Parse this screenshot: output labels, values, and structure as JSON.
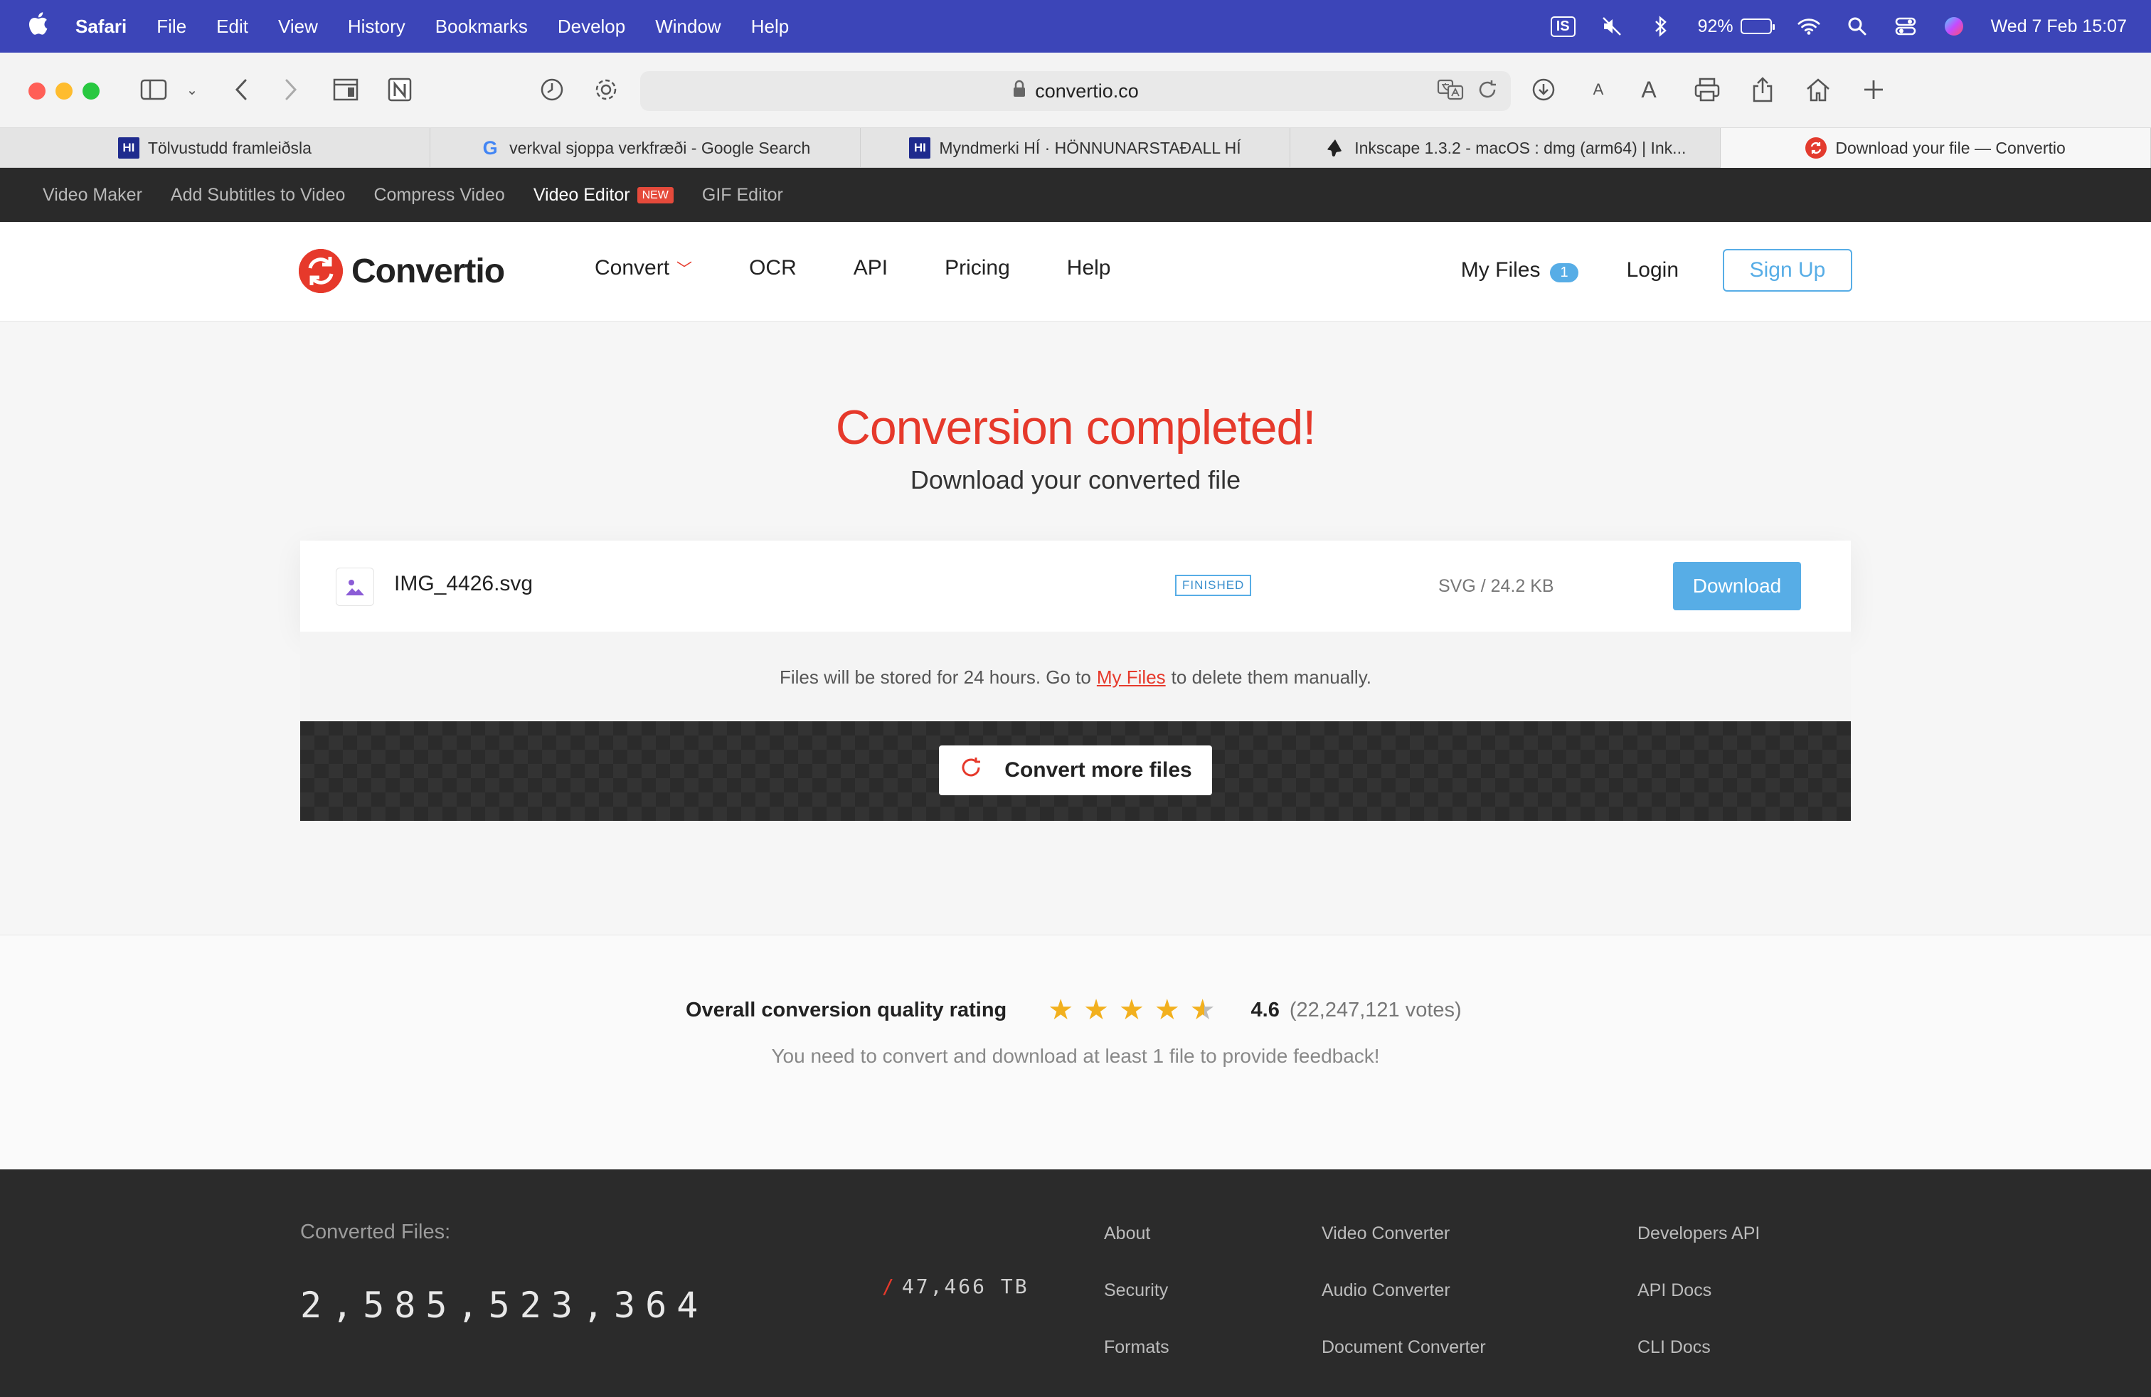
{
  "menubar": {
    "apple": "",
    "items": [
      "Safari",
      "File",
      "Edit",
      "View",
      "History",
      "Bookmarks",
      "Develop",
      "Window",
      "Help"
    ],
    "input_source": "IS",
    "battery_percent": "92%",
    "battery_level": 0.92,
    "datetime": "Wed 7 Feb  15:07"
  },
  "browser": {
    "url": "convertio.co",
    "tabs": [
      {
        "title": "Tölvustudd framleiðsla",
        "favicon": "HI"
      },
      {
        "title": "verkval sjoppa verkfræði - Google Search",
        "favicon": "G"
      },
      {
        "title": "Myndmerki HÍ · HÖNNUNARSTAÐALL HÍ",
        "favicon": "HI"
      },
      {
        "title": "Inkscape 1.3.2 - macOS : dmg (arm64) | Ink...",
        "favicon": "inkscape-icon"
      },
      {
        "title": "Download your file — Convertio",
        "favicon": "convertio-icon"
      }
    ],
    "text_size_small": "A",
    "text_size_large": "A"
  },
  "subnav": {
    "items": [
      "Video Maker",
      "Add Subtitles to Video",
      "Compress Video",
      "Video Editor",
      "GIF Editor"
    ],
    "new_badge": "NEW"
  },
  "header": {
    "logo_text": "Convertio",
    "nav": [
      "Convert",
      "OCR",
      "API",
      "Pricing",
      "Help"
    ],
    "my_files": "My Files",
    "my_files_count": "1",
    "login": "Login",
    "signup": "Sign Up"
  },
  "main": {
    "title": "Conversion completed!",
    "subtitle": "Download your converted file",
    "file": {
      "name": "IMG_4426.svg",
      "status": "FINISHED",
      "meta": "SVG / 24.2 KB",
      "download_label": "Download"
    },
    "storage_note_before": "Files will be stored for 24 hours. Go to",
    "storage_note_link": "My Files",
    "storage_note_after": "to delete them manually.",
    "convert_more_label": "Convert more files"
  },
  "rating": {
    "label": "Overall conversion quality rating",
    "stars": 4.6,
    "score": "4.6",
    "votes": "(22,247,121 votes)",
    "feedback": "You need to convert and download at least 1 file to provide feedback!"
  },
  "footer": {
    "converted_label": "Converted Files:",
    "converted_count": "2,585,523,364",
    "tb_slash": "/",
    "tb": "47,466 TB",
    "col1": [
      "About",
      "Security",
      "Formats"
    ],
    "col2": [
      "Video Converter",
      "Audio Converter",
      "Document Converter"
    ],
    "col3": [
      "Developers API",
      "API Docs",
      "CLI Docs"
    ]
  },
  "colors": {
    "brand_red": "#e6392b",
    "accent_blue": "#57ade6",
    "menubar": "#3c45b8",
    "footer": "#2b2b2b"
  }
}
